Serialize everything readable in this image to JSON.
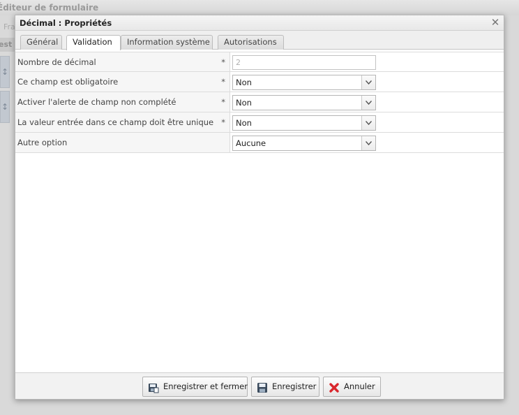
{
  "background": {
    "title": "Éditeur de formulaire",
    "toolbar_text": "Fra",
    "strip_text": "est",
    "handle_glyph": "↕"
  },
  "dialog": {
    "title": "Décimal : Propriétés",
    "close_glyph": "✕"
  },
  "tabs": [
    {
      "label": "Général",
      "active": false
    },
    {
      "label": "Validation",
      "active": true
    },
    {
      "label": "Information système",
      "active": false
    },
    {
      "label": "Autorisations",
      "active": false
    }
  ],
  "form": {
    "rows": [
      {
        "label": "Nombre de décimal",
        "required": "*",
        "type": "text",
        "value": "2"
      },
      {
        "label": "Ce champ est obligatoire",
        "required": "*",
        "type": "select",
        "value": "Non"
      },
      {
        "label": "Activer l'alerte de champ non complété",
        "required": "*",
        "type": "select",
        "value": "Non"
      },
      {
        "label": "La valeur entrée dans ce champ doit être unique",
        "required": "*",
        "type": "select",
        "value": "Non"
      },
      {
        "label": "Autre option",
        "required": "",
        "type": "select",
        "value": "Aucune"
      }
    ]
  },
  "footer": {
    "save_close_label": "Enregistrer et fermer",
    "save_label": "Enregistrer",
    "cancel_label": "Annuler"
  },
  "icons": {
    "save_close": "save-and-close-icon",
    "save": "floppy-disk-icon",
    "cancel": "red-x-icon",
    "dropdown": "chevron-down-icon",
    "close": "close-icon"
  },
  "colors": {
    "cancel_icon": "#d9262c",
    "floppy_icon": "#3a4a5c"
  }
}
